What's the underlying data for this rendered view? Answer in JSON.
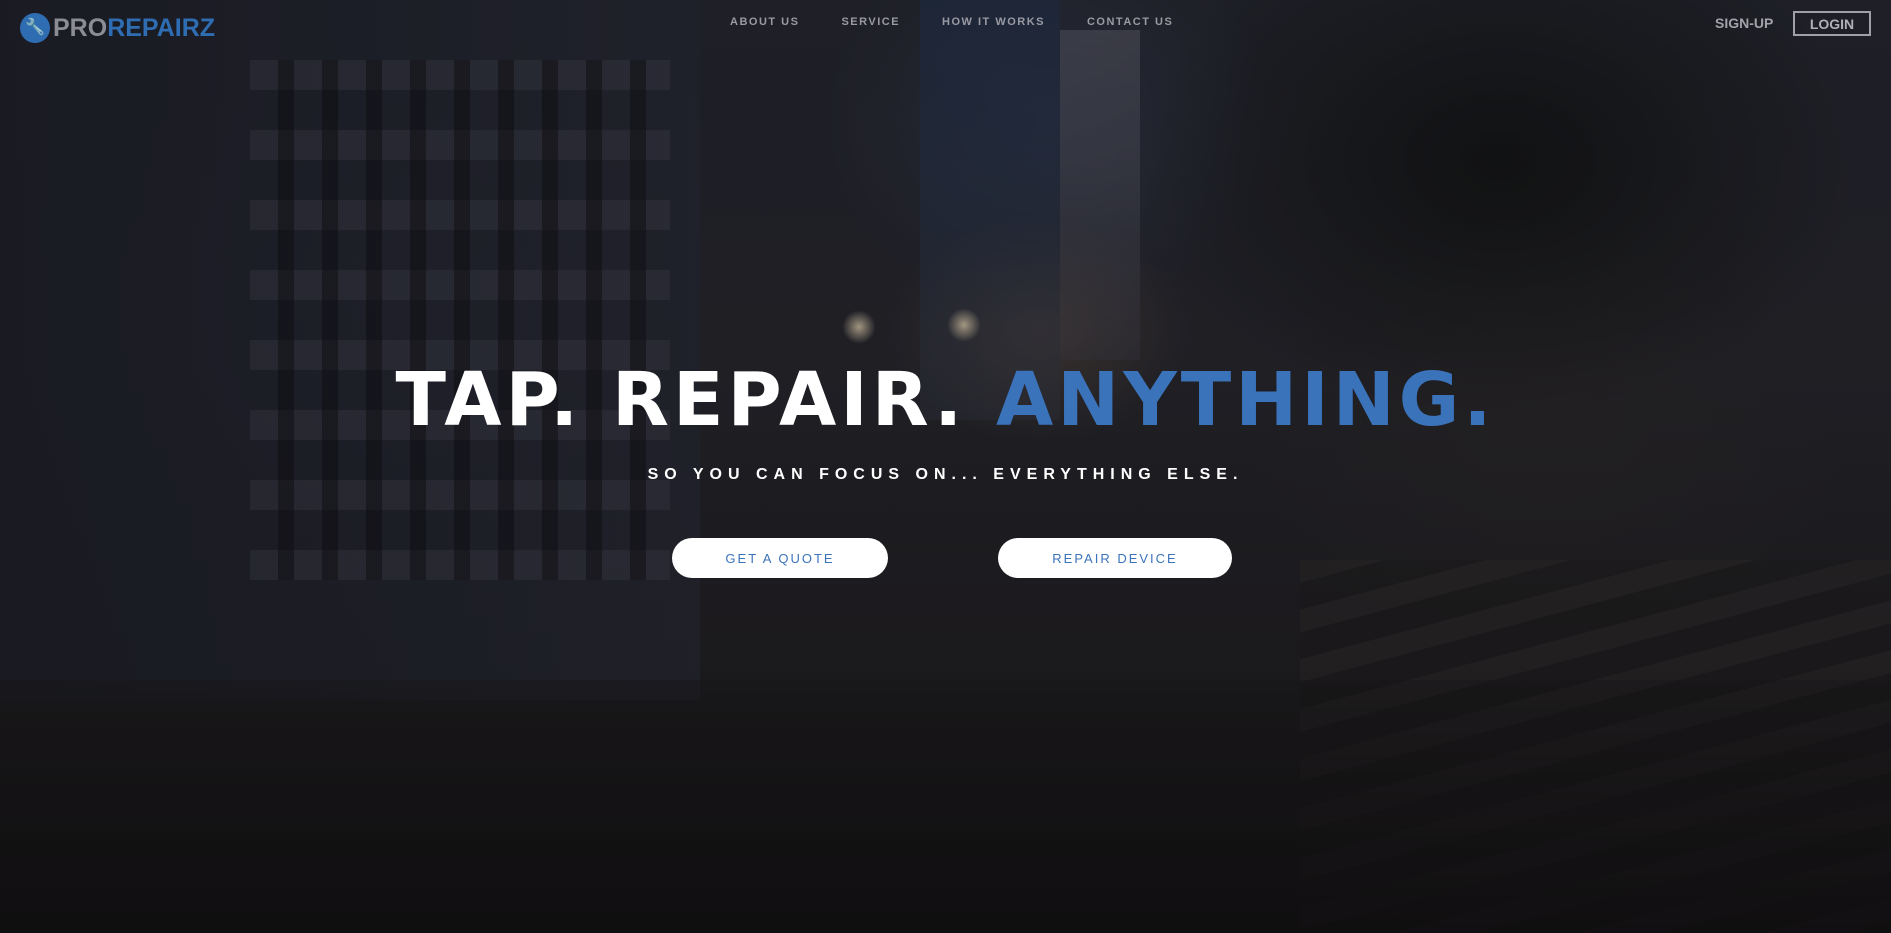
{
  "brand": {
    "icon": "wrench-icon",
    "name_part1": "PRO",
    "name_part2": "REPAIRZ",
    "color": "#2f6db3"
  },
  "nav": {
    "items": [
      {
        "label": "ABOUT US"
      },
      {
        "label": "SERVICE"
      },
      {
        "label": "HOW IT WORKS"
      },
      {
        "label": "CONTACT US"
      }
    ],
    "signup_label": "SIGN-UP",
    "login_label": "LOGIN"
  },
  "hero": {
    "headline_part1": "TAP. REPAIR. ",
    "headline_part2": "ANYTHING.",
    "subheadline": "SO YOU CAN FOCUS ON... EVERYTHING ELSE.",
    "accent_color": "#3b73bb",
    "buttons": [
      {
        "label": "GET A QUOTE"
      },
      {
        "label": "REPAIR DEVICE"
      }
    ]
  }
}
